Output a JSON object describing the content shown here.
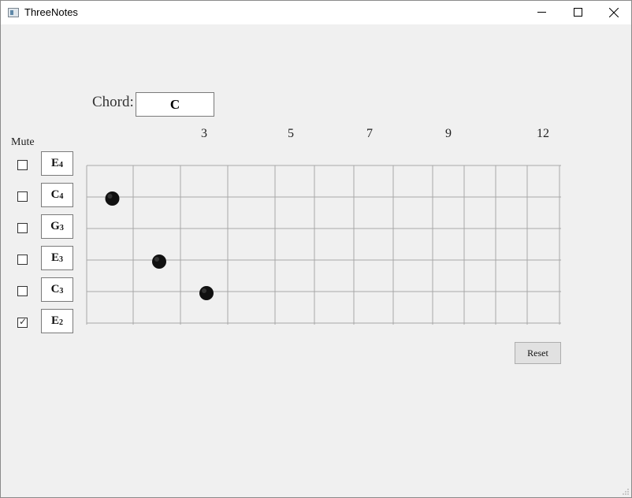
{
  "window": {
    "title": "ThreeNotes"
  },
  "chord": {
    "label": "Chord:",
    "value": "C"
  },
  "fret_numbers": [
    "3",
    "5",
    "7",
    "9",
    "12"
  ],
  "mute_label": "Mute",
  "strings": [
    {
      "note": "E",
      "octave": "4",
      "muted": false
    },
    {
      "note": "C",
      "octave": "4",
      "muted": false
    },
    {
      "note": "G",
      "octave": "3",
      "muted": false
    },
    {
      "note": "E",
      "octave": "3",
      "muted": false
    },
    {
      "note": "C",
      "octave": "3",
      "muted": false
    },
    {
      "note": "E",
      "octave": "2",
      "muted": true
    }
  ],
  "reset_label": "Reset",
  "markers": [
    {
      "string": 2,
      "fret": 1
    },
    {
      "string": 4,
      "fret": 2
    },
    {
      "string": 5,
      "fret": 3
    }
  ]
}
